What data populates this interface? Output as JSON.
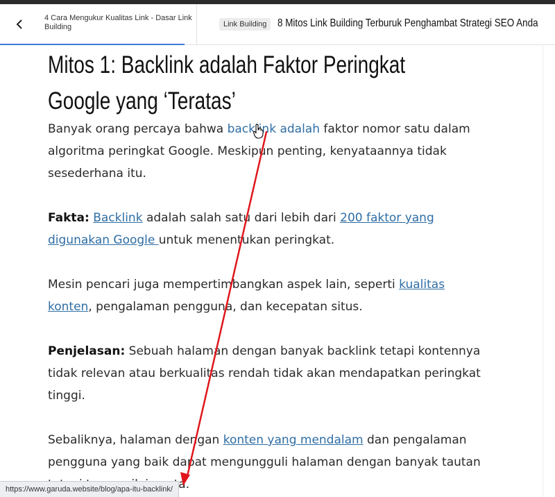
{
  "nav": {
    "previous_post": "4 Cara Mengukur Kualitas Link - Dasar Link Building",
    "category": "Link Building",
    "next_post": "8 Mitos Link Building Terburuk Penghambat Strategi SEO Anda"
  },
  "article": {
    "heading": "Mitos 1: Backlink adalah Faktor Peringkat Google yang ‘Teratas’",
    "p1": {
      "t1": "Banyak orang percaya bahwa ",
      "link": "backlink adalah",
      "t2": " faktor nomor satu dalam algoritma peringkat Google. Meskipun penting, kenyataannya tidak sesederhana itu."
    },
    "p2": {
      "label": "Fakta:",
      "t0": " ",
      "link1": "Backlink",
      "t1": " adalah salah satu dari lebih dari ",
      "link2": "200 faktor yang digunakan Google ",
      "t2": "untuk menentukan peringkat."
    },
    "p3": {
      "t1": "Mesin pencari juga mempertimbangkan aspek lain, seperti ",
      "link": "kualitas konten",
      "t2": ", pengalaman pengguna, dan kecepatan situs."
    },
    "p4": {
      "label": "Penjelasan:",
      "t1": " Sebuah halaman dengan banyak backlink tetapi kontennya tidak relevan atau berkualitas rendah tidak akan mendapatkan peringkat tinggi."
    },
    "p5": {
      "t1": "Sebaliknya, halaman dengan ",
      "link": "konten yang mendalam",
      "t2": " dan pengalaman pengguna yang baik dapat mengungguli halaman dengan banyak tautan tetapi tanpa nilai nyata."
    }
  },
  "status_bar": {
    "url": "https://www.garuda.website/blog/apa-itu-backlink/"
  },
  "colors": {
    "link": "#2e6da4",
    "annotation_arrow": "#e0161b",
    "nav_underline": "#3a7bd5"
  },
  "icons": {
    "back": "chevron-left-icon",
    "cursor": "hand-pointer-icon"
  }
}
